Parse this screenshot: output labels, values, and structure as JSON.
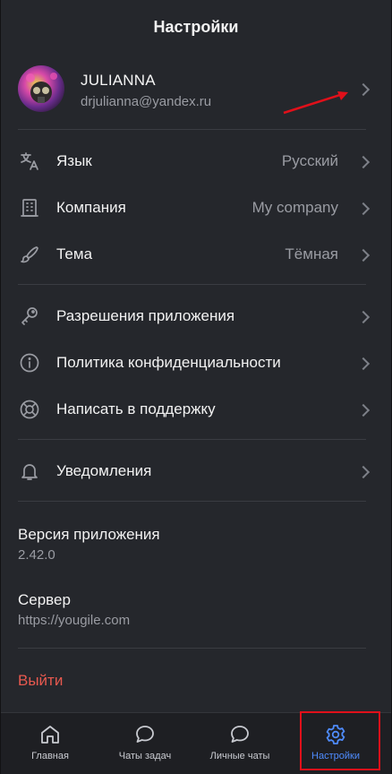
{
  "header": {
    "title": "Настройки"
  },
  "profile": {
    "name": "JULIANNA",
    "email": "drjulianna@yandex.ru"
  },
  "rows": {
    "language": {
      "label": "Язык",
      "value": "Русский"
    },
    "company": {
      "label": "Компания",
      "value": "My company"
    },
    "theme": {
      "label": "Тема",
      "value": "Тёмная"
    },
    "permissions": {
      "label": "Разрешения приложения"
    },
    "privacy": {
      "label": "Политика конфиденциальности"
    },
    "support": {
      "label": "Написать в поддержку"
    },
    "notifications": {
      "label": "Уведомления"
    }
  },
  "info": {
    "version_title": "Версия приложения",
    "version_value": "2.42.0",
    "server_title": "Сервер",
    "server_value": "https://yougile.com"
  },
  "logout": {
    "label": "Выйти"
  },
  "tabs": [
    {
      "label": "Главная"
    },
    {
      "label": "Чаты задач"
    },
    {
      "label": "Личные чаты"
    },
    {
      "label": "Настройки"
    }
  ],
  "colors": {
    "background": "#25272c",
    "accent": "#4f8cff",
    "danger": "#e8594f",
    "annotation": "#e0101a"
  },
  "icons": [
    "translate-icon",
    "building-icon",
    "brush-icon",
    "key-icon",
    "info-icon",
    "lifebuoy-icon",
    "bell-icon",
    "home-icon",
    "chat-icon",
    "gear-icon"
  ]
}
